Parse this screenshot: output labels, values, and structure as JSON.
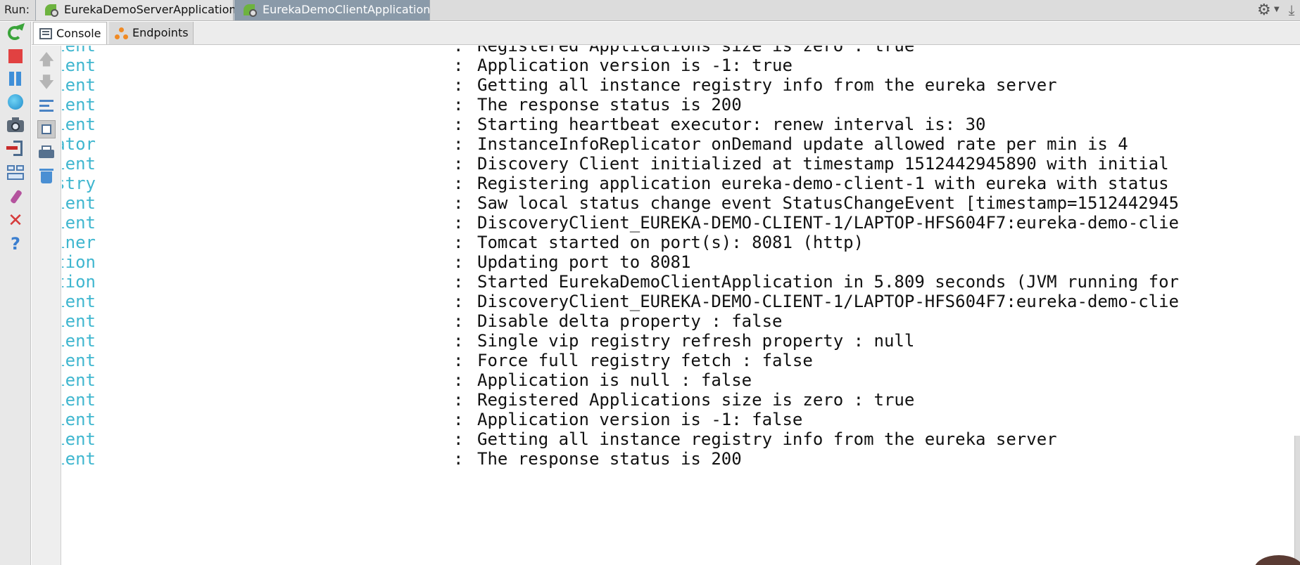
{
  "run_bar": {
    "label": "Run:",
    "tabs": [
      {
        "label": "EurekaDemoServerApplication",
        "active": false
      },
      {
        "label": "EurekaDemoClientApplication",
        "active": true
      }
    ]
  },
  "sub_tabs": [
    {
      "label": "Console",
      "active": true
    },
    {
      "label": "Endpoints",
      "active": false
    }
  ],
  "log_lines": [
    {
      "logger": "ix.discovery.DiscoveryClient",
      "message": "Registered Applications size is zero : true"
    },
    {
      "logger": "ix.discovery.DiscoveryClient",
      "message": "Application version is -1: true"
    },
    {
      "logger": "ix.discovery.DiscoveryClient",
      "message": "Getting all instance registry info from the eureka server"
    },
    {
      "logger": "ix.discovery.DiscoveryClient",
      "message": "The response status is 200"
    },
    {
      "logger": "ix.discovery.DiscoveryClient",
      "message": "Starting heartbeat executor: renew interval is: 30"
    },
    {
      "logger": "very.InstanceInfoReplicator",
      "message": "InstanceInfoReplicator onDemand update allowed rate per min is 4"
    },
    {
      "logger": "ix.discovery.DiscoveryClient",
      "message": "Discovery Client initialized at timestamp 1512442945890 with initial"
    },
    {
      "logger": ".s.EurekaServiceRegistry",
      "message": "Registering application eureka-demo-client-1 with eureka with status"
    },
    {
      "logger": "ix.discovery.DiscoveryClient",
      "message": "Saw local status change event StatusChangeEvent [timestamp=1512442945"
    },
    {
      "logger": "ix.discovery.DiscoveryClient",
      "message": "DiscoveryClient_EUREKA-DEMO-CLIENT-1/LAPTOP-HFS604F7:eureka-demo-clie"
    },
    {
      "logger": ".TomcatEmbeddedServletContainer",
      "message": "Tomcat started on port(s): 8081 (http)"
    },
    {
      "logger": "s.EurekaAutoServiceRegistration",
      "message": "Updating port to 8081"
    },
    {
      "logger": "ekaDemoClientApplication",
      "message": "Started EurekaDemoClientApplication in 5.809 seconds (JVM running for"
    },
    {
      "logger": "ix.discovery.DiscoveryClient",
      "message": "DiscoveryClient_EUREKA-DEMO-CLIENT-1/LAPTOP-HFS604F7:eureka-demo-clie"
    },
    {
      "logger": "ix.discovery.DiscoveryClient",
      "message": "Disable delta property : false"
    },
    {
      "logger": "ix.discovery.DiscoveryClient",
      "message": "Single vip registry refresh property : null"
    },
    {
      "logger": "ix.discovery.DiscoveryClient",
      "message": "Force full registry fetch : false"
    },
    {
      "logger": "ix.discovery.DiscoveryClient",
      "message": "Application is null : false"
    },
    {
      "logger": "ix.discovery.DiscoveryClient",
      "message": "Registered Applications size is zero : true"
    },
    {
      "logger": "ix.discovery.DiscoveryClient",
      "message": "Application version is -1: false"
    },
    {
      "logger": "ix.discovery.DiscoveryClient",
      "message": "Getting all instance registry info from the eureka server"
    },
    {
      "logger": "ix.discovery.DiscoveryClient",
      "message": "The response status is 200"
    }
  ],
  "separator": ":",
  "colors": {
    "logger": "#3fb6cf",
    "message": "#111111",
    "active_tab": "#8a9aa9"
  },
  "icons": {
    "left_toolbar": [
      "rerun-icon",
      "stop-icon",
      "pause-icon",
      "globe-icon",
      "screenshot-icon",
      "exit-icon",
      "layout-icon",
      "pin-icon",
      "close-icon",
      "help-icon"
    ],
    "console_toolbar": [
      "up-arrow-icon",
      "down-arrow-icon",
      "soft-wrap-icon",
      "scroll-to-end-icon",
      "print-icon",
      "trash-icon"
    ]
  }
}
